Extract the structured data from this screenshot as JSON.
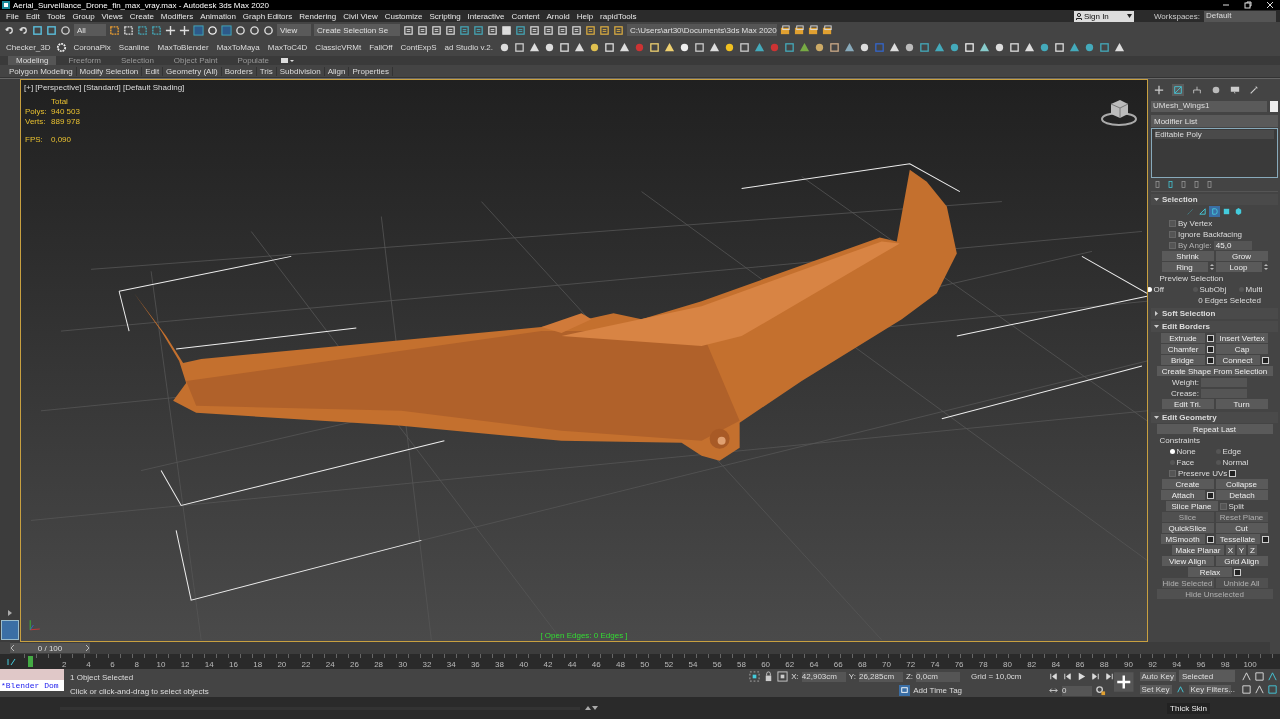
{
  "window": {
    "title": "Aerial_Surveillance_Drone_fin_max_vray.max - Autodesk 3ds Max 2020"
  },
  "menu": [
    "File",
    "Edit",
    "Tools",
    "Group",
    "Views",
    "Create",
    "Modifiers",
    "Animation",
    "Graph Editors",
    "Rendering",
    "Civil View",
    "Customize",
    "Scripting",
    "Interactive",
    "Content",
    "Arnold",
    "Help",
    "rapidTools"
  ],
  "main_toolbar": {
    "filter": "All",
    "reference": "View",
    "selection_set": "Create Selection Se",
    "project_path": "C:\\Users\\art30\\Documents\\3ds Max 2020",
    "sign_in": "Sign In",
    "workspaces_label": "Workspaces:",
    "workspace": "Default"
  },
  "script_buttons": [
    "Checker_3D",
    "CoronaPix",
    "Scanline",
    "MaxToBlender",
    "MaxToMaya",
    "MaxToC4D",
    "ClassicVRMt",
    "FallOff",
    "ContExpS",
    "ad Studio v.2."
  ],
  "ribbon_tabs": [
    {
      "label": "Modeling",
      "selected": true
    },
    {
      "label": "Freeform",
      "selected": false
    },
    {
      "label": "Selection",
      "selected": false
    },
    {
      "label": "Object Paint",
      "selected": false
    },
    {
      "label": "Populate",
      "selected": false
    }
  ],
  "ribbon_panels": [
    "Polygon Modeling",
    "Modify Selection",
    "Edit",
    "Geometry (All)",
    "Borders",
    "Tris",
    "Subdivision",
    "Align",
    "Properties"
  ],
  "viewport": {
    "label": "[+] [Perspective] [Standard] [Default Shading]",
    "stats_heading": "Total",
    "stats": [
      {
        "label": "Polys:",
        "value": "940 503"
      },
      {
        "label": "Verts:",
        "value": "889 978"
      }
    ],
    "fps_label": "FPS:",
    "fps": "0,090",
    "status": "[ Open Edges: 0 Edges ]"
  },
  "panel": {
    "command_tabs": [
      {
        "selected": false
      },
      {
        "selected": true
      },
      {
        "selected": false
      },
      {
        "selected": false
      },
      {
        "selected": false
      },
      {
        "selected": false
      }
    ],
    "object_name": "UMesh_Wings1",
    "modifier_list": "Modifier List",
    "stack": [
      "Editable Poly"
    ],
    "subobject_levels": [
      {
        "selected": false
      },
      {
        "selected": false
      },
      {
        "selected": true
      },
      {
        "selected": false
      },
      {
        "selected": false
      }
    ],
    "rollouts": [
      {
        "title": "Selection",
        "expanded": true,
        "rows": [
          [
            {
              "kind": "check",
              "label": "By Vertex",
              "checked": false,
              "disabled": false
            }
          ],
          [
            {
              "kind": "check",
              "label": "Ignore Backfacing",
              "checked": false,
              "disabled": false
            }
          ],
          [
            {
              "kind": "check_spin",
              "label": "By Angle:",
              "value": "45,0",
              "checked": false,
              "disabled": true
            }
          ],
          [
            {
              "kind": "button",
              "label": "Shrink",
              "disabled": false
            },
            {
              "kind": "button",
              "label": "Grow",
              "disabled": false
            }
          ],
          [
            {
              "kind": "button_spin",
              "label": "Ring",
              "disabled": false
            },
            {
              "kind": "button_spin",
              "label": "Loop",
              "disabled": false
            }
          ],
          [
            {
              "kind": "caption",
              "label": "Preview Selection"
            }
          ],
          [
            {
              "kind": "radio",
              "label": "Off",
              "selected": true
            },
            {
              "kind": "radio",
              "label": "SubObj",
              "selected": false
            },
            {
              "kind": "radio",
              "label": "Multi",
              "selected": false
            }
          ],
          [
            {
              "kind": "text",
              "label": "0 Edges Selected"
            }
          ]
        ]
      },
      {
        "title": "Soft Selection",
        "expanded": false
      },
      {
        "title": "Edit Borders",
        "expanded": true,
        "rows": [
          [
            {
              "kind": "button_set",
              "label": "Extrude",
              "disabled": false
            },
            {
              "kind": "button",
              "label": "Insert Vertex",
              "disabled": false
            }
          ],
          [
            {
              "kind": "button_set",
              "label": "Chamfer",
              "disabled": false
            },
            {
              "kind": "button",
              "label": "Cap",
              "disabled": false
            }
          ],
          [
            {
              "kind": "button_set",
              "label": "Bridge",
              "disabled": false
            },
            {
              "kind": "button_set",
              "label": "Connect",
              "disabled": false
            }
          ],
          [
            {
              "kind": "wide",
              "label": "Create Shape From Selection",
              "disabled": false
            }
          ],
          [
            {
              "kind": "spinner",
              "label": "Weight:"
            }
          ],
          [
            {
              "kind": "spinner",
              "label": "Crease:"
            }
          ],
          [
            {
              "kind": "button",
              "label": "Edit Tri.",
              "disabled": false
            },
            {
              "kind": "button",
              "label": "Turn",
              "disabled": false
            }
          ]
        ]
      },
      {
        "title": "Edit Geometry",
        "expanded": true,
        "rows": [
          [
            {
              "kind": "wide",
              "label": "Repeat Last",
              "disabled": false
            }
          ],
          [
            {
              "kind": "caption",
              "label": "Constraints"
            }
          ],
          [
            {
              "kind": "radio",
              "label": "None",
              "selected": true
            },
            {
              "kind": "radio",
              "label": "Edge",
              "selected": false
            }
          ],
          [
            {
              "kind": "radio",
              "label": "Face",
              "selected": false
            },
            {
              "kind": "radio",
              "label": "Normal",
              "selected": false
            }
          ],
          [
            {
              "kind": "check_set",
              "label": "Preserve UVs",
              "checked": false,
              "disabled": false
            }
          ],
          [
            {
              "kind": "button",
              "label": "Create",
              "disabled": false
            },
            {
              "kind": "button",
              "label": "Collapse",
              "disabled": false
            }
          ],
          [
            {
              "kind": "button_set",
              "label": "Attach",
              "disabled": false
            },
            {
              "kind": "button",
              "label": "Detach",
              "disabled": false
            }
          ],
          [
            {
              "kind": "button",
              "label": "Slice Plane",
              "disabled": false
            },
            {
              "kind": "check",
              "label": "Split",
              "checked": false,
              "disabled": false
            }
          ],
          [
            {
              "kind": "button",
              "label": "Slice",
              "disabled": true
            },
            {
              "kind": "button",
              "label": "Reset Plane",
              "disabled": true
            }
          ],
          [
            {
              "kind": "button",
              "label": "QuickSlice",
              "disabled": false
            },
            {
              "kind": "button",
              "label": "Cut",
              "disabled": false
            }
          ],
          [
            {
              "kind": "button_set",
              "label": "MSmooth",
              "disabled": false
            },
            {
              "kind": "button_set",
              "label": "Tessellate",
              "disabled": false
            }
          ],
          [
            {
              "kind": "button",
              "label": "Make Planar",
              "disabled": false
            },
            {
              "kind": "axis",
              "label": "X",
              "disabled": false
            },
            {
              "kind": "axis",
              "label": "Y",
              "disabled": false
            },
            {
              "kind": "axis",
              "label": "Z",
              "disabled": false
            }
          ],
          [
            {
              "kind": "button",
              "label": "View Align",
              "disabled": false
            },
            {
              "kind": "button",
              "label": "Grid Align",
              "disabled": false
            }
          ],
          [
            {
              "kind": "button_set",
              "label": "Relax",
              "disabled": false
            }
          ],
          [
            {
              "kind": "button",
              "label": "Hide Selected",
              "disabled": true
            },
            {
              "kind": "button",
              "label": "Unhide All",
              "disabled": true
            }
          ],
          [
            {
              "kind": "wide",
              "label": "Hide Unselected",
              "disabled": true
            }
          ]
        ]
      }
    ]
  },
  "time_slider": {
    "label": "0 / 100",
    "level": 0
  },
  "timeline": {
    "ticks": [
      "2",
      "4",
      "6",
      "8",
      "10",
      "12",
      "14",
      "16",
      "18",
      "20",
      "22",
      "24",
      "26",
      "28",
      "30",
      "32",
      "34",
      "36",
      "38",
      "40",
      "42",
      "44",
      "46",
      "48",
      "50",
      "52",
      "54",
      "56",
      "58",
      "60",
      "62",
      "64",
      "66",
      "68",
      "70",
      "72",
      "74",
      "76",
      "78",
      "80",
      "82",
      "84",
      "86",
      "88",
      "90",
      "92",
      "94",
      "96",
      "98",
      "100"
    ]
  },
  "status_bar": {
    "listener": "*Blender Dom",
    "selection": "1 Object Selected",
    "prompt": "Click or click-and-drag to select objects",
    "x_label": "X:",
    "x": "42,903cm",
    "y_label": "Y:",
    "y": "26,285cm",
    "z_label": "Z:",
    "z": "0,0cm",
    "grid": "Grid = 10,0cm",
    "time_tag": "Add Time Tag",
    "frame": "0",
    "auto_key": "Auto Key",
    "key_mode": "Selected",
    "set_key": "Set Key",
    "key_filters": "Key Filters...",
    "tooltip": "Thick Skin"
  }
}
